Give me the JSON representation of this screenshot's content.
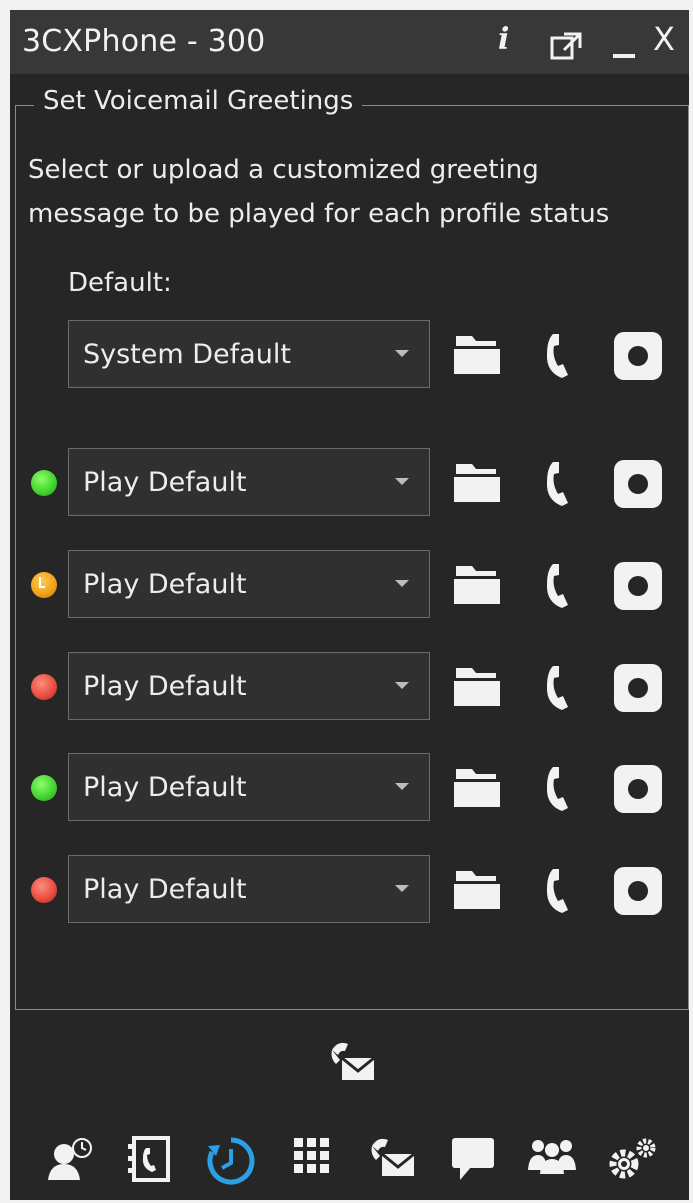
{
  "window": {
    "title": "3CXPhone - 300",
    "controls": {
      "info_label": "i",
      "close_label": "X"
    }
  },
  "greetings": {
    "group_title": "Set Voicemail Greetings",
    "description_line1": "Select or upload a customized greeting",
    "description_line2": "message to be played for each profile status",
    "default_label": "Default:",
    "default_value": "System Default",
    "statuses": [
      {
        "status": "available",
        "color": "#3fd12c",
        "value": "Play Default"
      },
      {
        "status": "away",
        "color": "#f0a015",
        "value": "Play Default"
      },
      {
        "status": "do-not-disturb",
        "color": "#e64a3c",
        "value": "Play Default"
      },
      {
        "status": "custom-available",
        "color": "#3fd12c",
        "value": "Play Default"
      },
      {
        "status": "custom-busy",
        "color": "#e64a3c",
        "value": "Play Default"
      }
    ]
  },
  "icons": {
    "row_actions": [
      "folder-icon",
      "phone-icon",
      "record-icon"
    ],
    "bottom_nav": [
      "presence-icon",
      "contacts-icon",
      "call-history-icon",
      "dialpad-icon",
      "voicemail-icon",
      "chat-icon",
      "conference-icon",
      "settings-icon"
    ]
  },
  "colors": {
    "background": "#262626",
    "titlebar": "#383838",
    "accent": "#2aa0e6"
  }
}
